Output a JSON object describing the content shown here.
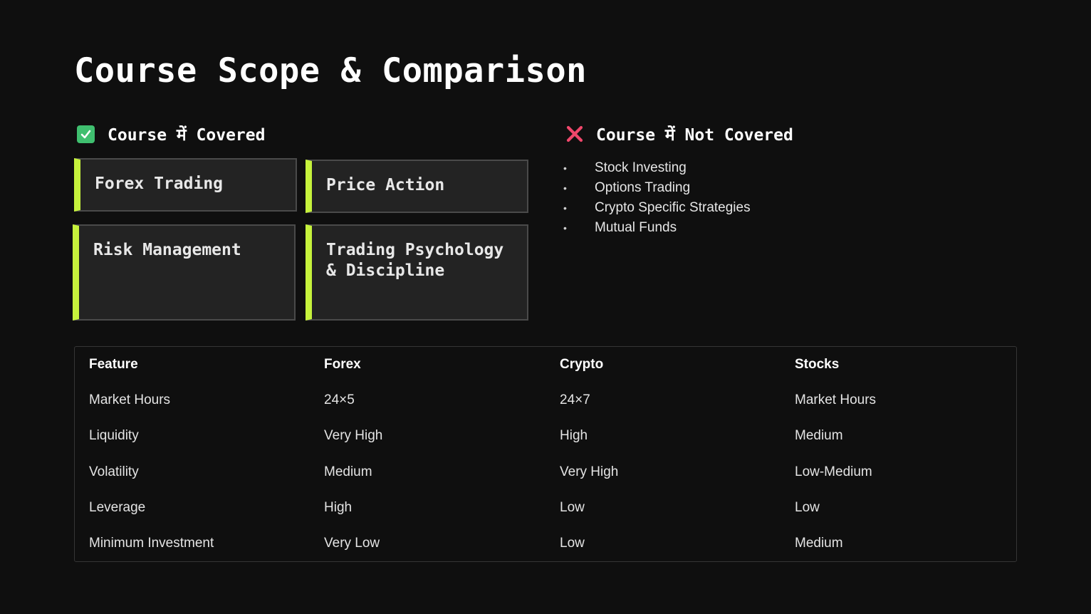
{
  "slide": {
    "title": "Course Scope & Comparison"
  },
  "covered": {
    "heading": "Course में Covered",
    "icon": "check-icon",
    "accent_color": "#c6f23c",
    "cards": [
      {
        "label": "Forex Trading"
      },
      {
        "label": "Price Action"
      },
      {
        "label": "Risk Management"
      },
      {
        "label": "Trading Psychology & Discipline"
      }
    ]
  },
  "not_covered": {
    "heading": "Course में Not Covered",
    "icon": "cross-icon",
    "items": [
      {
        "label": "Stock Investing"
      },
      {
        "label": "Options Trading"
      },
      {
        "label": "Crypto Specific Strategies"
      },
      {
        "label": "Mutual Funds"
      }
    ]
  },
  "comparison": {
    "headers": [
      "Feature",
      "Forex",
      "Crypto",
      "Stocks"
    ],
    "rows": [
      [
        "Market Hours",
        "24×5",
        "24×7",
        "Market Hours"
      ],
      [
        "Liquidity",
        "Very High",
        "High",
        "Medium"
      ],
      [
        "Volatility",
        "Medium",
        "Very High",
        "Low-Medium"
      ],
      [
        "Leverage",
        "High",
        "Low",
        "Low"
      ],
      [
        "Minimum Investment",
        "Very Low",
        "Low",
        "Medium"
      ]
    ]
  }
}
